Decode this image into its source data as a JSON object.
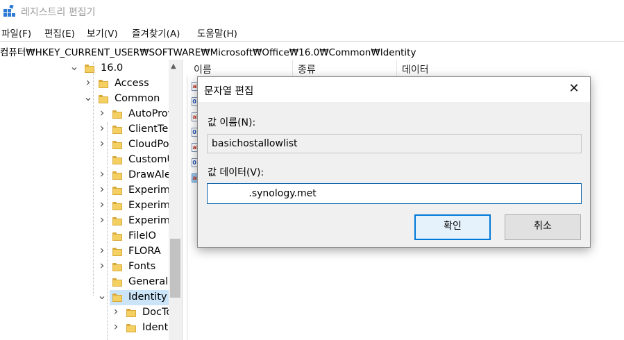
{
  "window": {
    "title": "레지스트리 편집기"
  },
  "menu": [
    "파일(F)",
    "편집(E)",
    "보기(V)",
    "즐겨찾기(A)",
    "도움말(H)"
  ],
  "address": "컴퓨터₩HKEY_CURRENT_USER₩SOFTWARE₩Microsoft₩Office₩16.0₩Common₩Identity",
  "tree": [
    {
      "label": "16.0",
      "expander": "expanded"
    },
    {
      "label": "Access",
      "expander": "collapsed"
    },
    {
      "label": "Common",
      "expander": "expanded"
    },
    {
      "label": "AutoProv",
      "expander": "collapsed"
    },
    {
      "label": "ClientTe",
      "expander": "collapsed"
    },
    {
      "label": "CloudPo",
      "expander": "collapsed"
    },
    {
      "label": "CustomU",
      "expander": "none"
    },
    {
      "label": "DrawAle",
      "expander": "collapsed"
    },
    {
      "label": "Experime",
      "expander": "collapsed"
    },
    {
      "label": "Experime",
      "expander": "collapsed"
    },
    {
      "label": "Experime",
      "expander": "collapsed"
    },
    {
      "label": "FileIO",
      "expander": "none"
    },
    {
      "label": "FLORA",
      "expander": "collapsed"
    },
    {
      "label": "Fonts",
      "expander": "collapsed"
    },
    {
      "label": "General",
      "expander": "none"
    },
    {
      "label": "Identity",
      "expander": "expanded",
      "selected": true
    },
    {
      "label": "DocTo",
      "expander": "collapsed"
    },
    {
      "label": "Identi",
      "expander": "collapsed"
    }
  ],
  "columns": {
    "name": "이름",
    "type": "종류",
    "data": "데이터"
  },
  "value_icons": [
    "string-value-icon",
    "dword-value-icon",
    "string-value-icon",
    "dword-value-icon",
    "string-value-icon",
    "dword-value-icon",
    "string-value-icon-selected"
  ],
  "dialog": {
    "title": "문자열 편집",
    "name_label": "값 이름(N):",
    "name_value": "basichostallowlist",
    "data_label": "값 데이터(V):",
    "data_value": "            .synology.met",
    "ok": "확인",
    "cancel": "취소",
    "close": "✕"
  },
  "colors": {
    "selection": "#cce4f7",
    "focus_border": "#0078d7",
    "folder": "#f4cf62"
  }
}
